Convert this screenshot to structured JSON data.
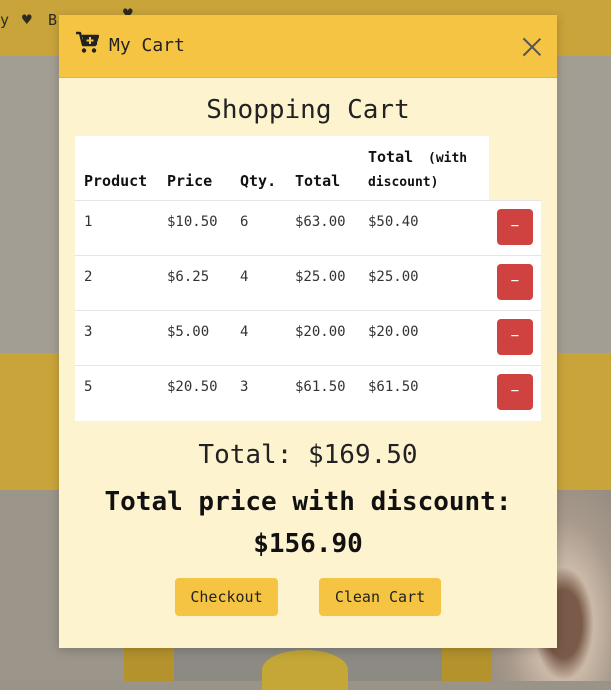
{
  "background": {
    "nav_fragment": "y",
    "nav_b": "B",
    "side_fragment": ")"
  },
  "modal": {
    "title": "My Cart",
    "heading": "Shopping Cart",
    "columns": [
      "Product",
      "Price",
      "Qty.",
      "Total",
      "Total",
      "(with",
      "discount)"
    ],
    "rows": [
      {
        "product": "1",
        "price": "$10.50",
        "qty": "6",
        "total": "$63.00",
        "discount_total": "$50.40",
        "remove": "−"
      },
      {
        "product": "2",
        "price": "$6.25",
        "qty": "4",
        "total": "$25.00",
        "discount_total": "$25.00",
        "remove": "−"
      },
      {
        "product": "3",
        "price": "$5.00",
        "qty": "4",
        "total": "$20.00",
        "discount_total": "$20.00",
        "remove": "−"
      },
      {
        "product": "5",
        "price": "$20.50",
        "qty": "3",
        "total": "$61.50",
        "discount_total": "$61.50",
        "remove": "−"
      }
    ],
    "total_text": "Total: $169.50",
    "discount_label": "Total price with discount:",
    "discount_value": "$156.90",
    "checkout_label": "Checkout",
    "clean_label": "Clean Cart"
  },
  "colors": {
    "header": "#f5c443",
    "modal_bg": "#fdf3cf",
    "remove_button": "#d0423f"
  }
}
